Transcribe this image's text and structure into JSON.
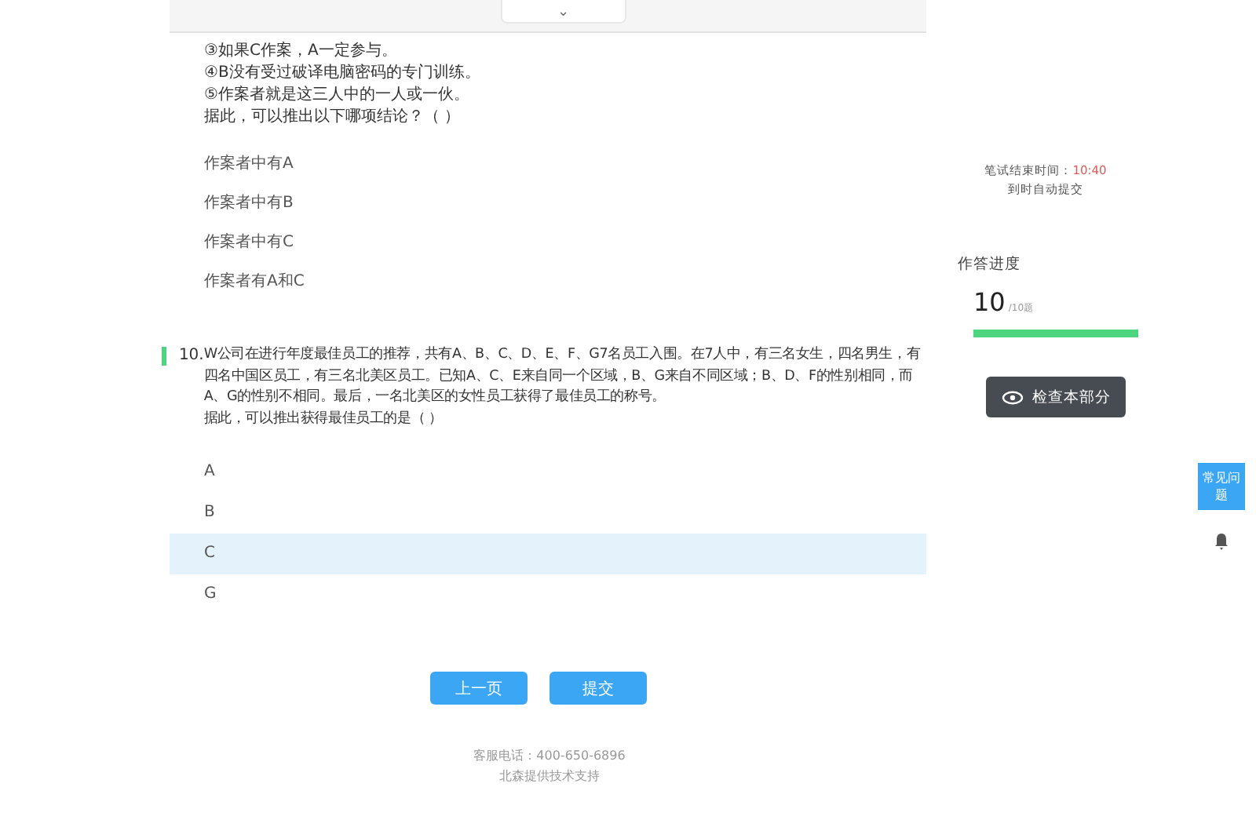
{
  "top_tab": {
    "icon": "⌄"
  },
  "question_9": {
    "lines": [
      "③如果C作案，A一定参与。",
      "④B没有受过破译电脑密码的专门训练。",
      "⑤作案者就是这三人中的一人或一伙。",
      "据此，可以推出以下哪项结论？（ ）"
    ],
    "options": [
      {
        "text": "作案者中有A",
        "selected": false
      },
      {
        "text": "作案者中有B",
        "selected": false
      },
      {
        "text": "作案者中有C",
        "selected": false
      },
      {
        "text": "作案者有A和C",
        "selected": false
      }
    ]
  },
  "question_10": {
    "number": "10.",
    "current": true,
    "text": "W公司在进行年度最佳员工的推荐，共有A、B、C、D、E、F、G7名员工入围。在7人中，有三名女生，四名男生，有四名中国区员工，有三名北美区员工。已知A、C、E来自同一个区域，B、G来自不同区域；B、D、F的性别相同，而A、G的性别不相同。最后，一名北美区的女性员工获得了最佳员工的称号。",
    "prompt": "据此，可以推出获得最佳员工的是（ ）",
    "options": [
      {
        "text": "A",
        "selected": false
      },
      {
        "text": "B",
        "selected": false
      },
      {
        "text": "C",
        "selected": true
      },
      {
        "text": "G",
        "selected": false
      }
    ]
  },
  "buttons": [
    {
      "label": "上一页"
    },
    {
      "label": "提交"
    }
  ],
  "footer": {
    "phone": "客服电话：400-650-6896",
    "support": "北森提供技术支持"
  },
  "sidebar": {
    "timer_label": "笔试结束时间：",
    "timer_value": "10:40",
    "auto_submit": "到时自动提交",
    "progress_title": "作答进度",
    "answered": "10",
    "total": "/10题",
    "level": 1.0,
    "check_button": "检查本部分"
  },
  "help_button": {
    "label": "常见问题"
  }
}
